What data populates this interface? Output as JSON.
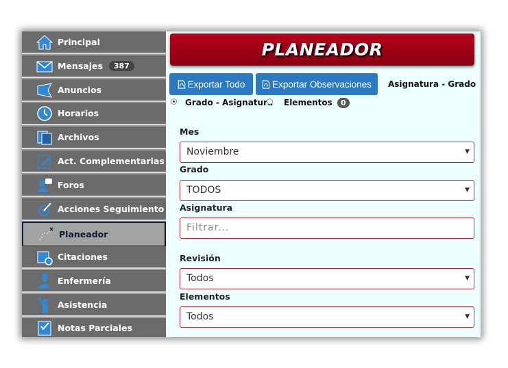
{
  "sidebar": {
    "items": [
      {
        "label": "Principal",
        "icon": "home-icon"
      },
      {
        "label": "Mensajes",
        "icon": "envelope-icon",
        "badge": "387"
      },
      {
        "label": "Anuncios",
        "icon": "megaphone-icon"
      },
      {
        "label": "Horarios",
        "icon": "clock-icon"
      },
      {
        "label": "Archivos",
        "icon": "files-icon"
      },
      {
        "label": "Act. Complementarias",
        "icon": "notepad-icon"
      },
      {
        "label": "Foros",
        "icon": "forum-icon"
      },
      {
        "label": "Acciones Seguimiento",
        "icon": "tracking-icon"
      },
      {
        "label": "Planeador",
        "icon": "planner-icon",
        "active": true
      },
      {
        "label": "Citaciones",
        "icon": "calendar-clock-icon"
      },
      {
        "label": "Enfermería",
        "icon": "nurse-icon"
      },
      {
        "label": "Asistencia",
        "icon": "person-raising-hand-icon"
      },
      {
        "label": "Notas Parciales",
        "icon": "checklist-icon"
      }
    ]
  },
  "banner": {
    "title": "PLANEADOR"
  },
  "toolbar": {
    "export_all_label": "Exportar Todo",
    "export_obs_label": "Exportar Observaciones",
    "pdf_icon": "pdf-file-icon"
  },
  "view_options": {
    "asignatura_grado": "Asignatura - Grado",
    "grado_asignatura": "Grado - Asignatura",
    "elementos": "Elementos",
    "elementos_count": "0"
  },
  "form": {
    "mes": {
      "label": "Mes",
      "value": "Noviembre"
    },
    "grado": {
      "label": "Grado",
      "value": "TODOS"
    },
    "asignatura": {
      "label": "Asignatura",
      "placeholder": "Filtrar..."
    },
    "revision": {
      "label": "Revisión",
      "value": "Todos"
    },
    "elementos": {
      "label": "Elementos",
      "value": "Todos"
    }
  },
  "colors": {
    "banner": "#a00018",
    "button": "#2b79c0",
    "sidebar_item": "#6b6b6b",
    "main_bg": "#edfefe",
    "select_border": "#c0202a"
  }
}
